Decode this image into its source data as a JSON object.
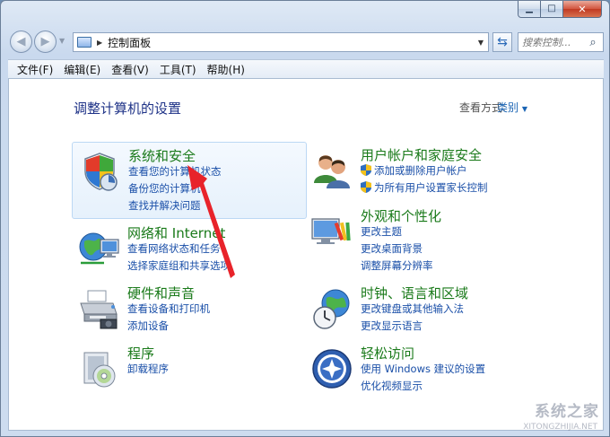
{
  "window": {
    "caption_buttons": {
      "minimize": "▁",
      "maximize": "□",
      "close": "✕"
    }
  },
  "nav": {
    "back_icon": "arrow-left-icon",
    "forward_icon": "arrow-right-icon",
    "breadcrumb": "控制面板",
    "refresh_icon": "refresh-icon",
    "search_placeholder": "搜索控制..."
  },
  "menubar": {
    "items": [
      {
        "label": "文件(F)"
      },
      {
        "label": "编辑(E)"
      },
      {
        "label": "查看(V)"
      },
      {
        "label": "工具(T)"
      },
      {
        "label": "帮助(H)"
      }
    ]
  },
  "main": {
    "title": "调整计算机的设置",
    "view_by_label": "查看方式:",
    "view_by_value": "类别"
  },
  "categories": [
    {
      "title": "系统和安全",
      "icon": "shield-icon",
      "links": [
        "查看您的计算机状态",
        "备份您的计算机",
        "查找并解决问题"
      ]
    },
    {
      "title": "网络和 Internet",
      "icon": "network-globe-icon",
      "links": [
        "查看网络状态和任务",
        "选择家庭组和共享选项"
      ]
    },
    {
      "title": "硬件和声音",
      "icon": "printer-icon",
      "links": [
        "查看设备和打印机",
        "添加设备"
      ]
    },
    {
      "title": "程序",
      "icon": "programs-disc-icon",
      "links": [
        "卸载程序"
      ]
    },
    {
      "title": "用户帐户和家庭安全",
      "icon": "users-icon",
      "links": [
        "添加或删除用户帐户",
        "为所有用户设置家长控制"
      ]
    },
    {
      "title": "外观和个性化",
      "icon": "monitor-palette-icon",
      "links": [
        "更改主题",
        "更改桌面背景",
        "调整屏幕分辨率"
      ]
    },
    {
      "title": "时钟、语言和区域",
      "icon": "clock-globe-icon",
      "links": [
        "更改键盘或其他输入法",
        "更改显示语言"
      ]
    },
    {
      "title": "轻松访问",
      "icon": "ease-of-access-icon",
      "links": [
        "使用 Windows 建议的设置",
        "优化视频显示"
      ]
    }
  ],
  "watermark": {
    "text": "系统之家",
    "sub": "XITONGZHIJIA.NET"
  },
  "colors": {
    "link": "#1a4fa8",
    "category_title": "#1a7a1a",
    "page_title": "#1e3287",
    "annotation_arrow": "#e8232a"
  }
}
